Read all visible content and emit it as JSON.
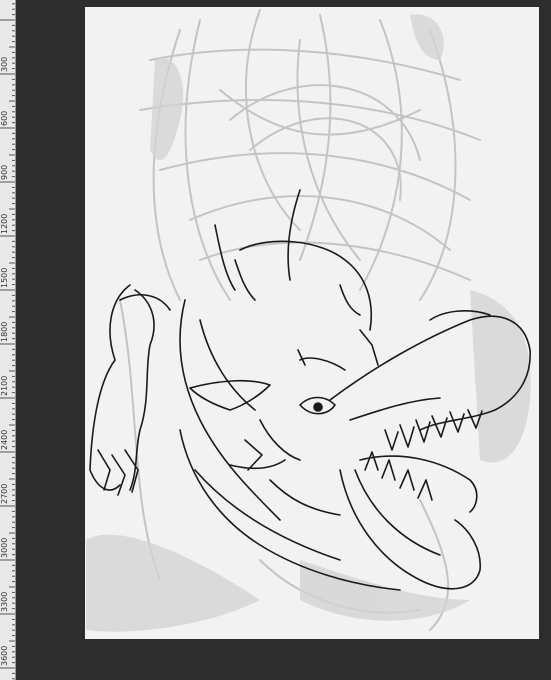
{
  "ruler": {
    "units": "px",
    "labels": [
      "300",
      "600",
      "900",
      "1200",
      "1500",
      "1800",
      "2100",
      "2400",
      "2700",
      "3000",
      "3300",
      "3600"
    ]
  },
  "canvas": {
    "background": "#f2f2f2",
    "subject": "pencil-sketch-dragon"
  },
  "colors": {
    "workspace": "#2b2b2b",
    "ruler": "#e9e9e9",
    "sketch_light": "#bdbdbd",
    "sketch_dark": "#1a1a1a"
  }
}
